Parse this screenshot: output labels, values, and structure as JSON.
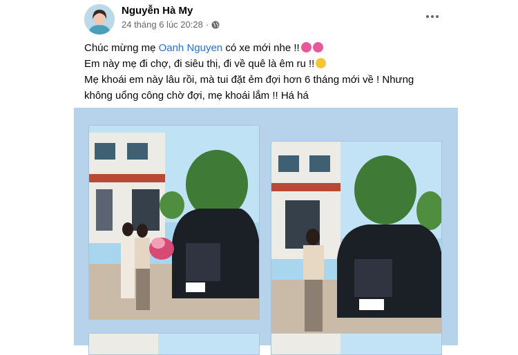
{
  "post": {
    "author": "Nguyễn Hà My",
    "timestamp": "24 tháng 6 lúc 20:28",
    "line1_before": "Chúc mừng mẹ ",
    "mention": "Oanh Nguyen",
    "line1_after": " có xe mới nhe !!",
    "line2": "Em này mẹ đi chợ, đi siêu thị, đi về quê là êm ru !!",
    "line3": "Mẹ khoái em này lâu rồi, mà tui đặt ẻm đợi hơn 6 tháng mới về ! Nhưng không uổng công chờ đợi, mẹ khoái lắm !! Há há"
  },
  "icons": {
    "privacy": "globe-icon",
    "more": "more-options-icon",
    "emoji_flower": "flower-emoji",
    "emoji_wink": "wink-emoji"
  },
  "colors": {
    "mention": "#216fdb",
    "meta_text": "#65676b",
    "photo_background": "#b7d3ec"
  }
}
